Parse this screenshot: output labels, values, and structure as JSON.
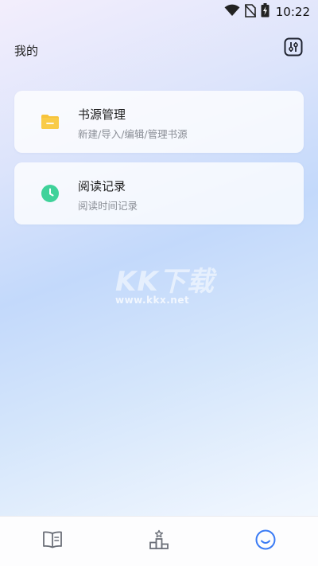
{
  "status_bar": {
    "time": "10:22",
    "icons": [
      "wifi-icon",
      "no-sim-icon",
      "battery-charging-icon"
    ]
  },
  "header": {
    "title": "我的",
    "settings_icon": "settings-sliders-icon"
  },
  "menu": [
    {
      "title": "书源管理",
      "subtitle": "新建/导入/编辑/管理书源",
      "icon": "folder-icon",
      "icon_color": "#f7c33c"
    },
    {
      "title": "阅读记录",
      "subtitle": "阅读时间记录",
      "icon": "clock-icon",
      "icon_color": "#3fd29a"
    }
  ],
  "watermark": {
    "logo": "KK下载",
    "url": "www.kkx.net"
  },
  "bottom_nav": {
    "items": [
      {
        "icon": "book-icon",
        "active": false
      },
      {
        "icon": "ranking-icon",
        "active": false
      },
      {
        "icon": "smile-icon",
        "active": true
      }
    ],
    "active_color": "#3a7bf5",
    "inactive_color": "#6b6f78"
  }
}
